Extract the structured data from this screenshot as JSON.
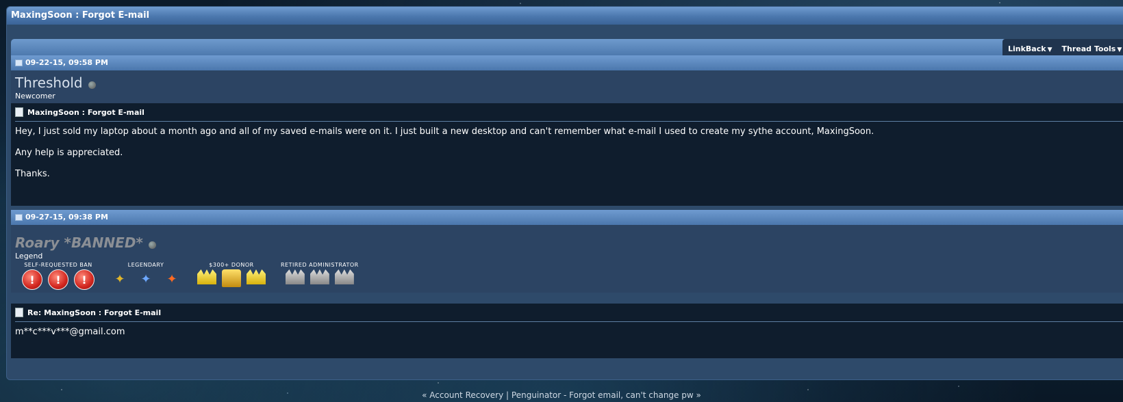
{
  "thread": {
    "title": "MaxingSoon : Forgot E-mail"
  },
  "toolbar": {
    "linkback": "LinkBack",
    "thread_tools": "Thread Tools"
  },
  "posts": [
    {
      "date": "09-22-15, 09:58 PM",
      "username": "Threshold",
      "usertitle": "Newcomer",
      "title": "MaxingSoon : Forgot E-mail",
      "paragraphs": [
        "Hey, I just sold my laptop about a month ago and all of my saved e-mails were on it. I just built a new desktop and can't remember what e-mail I used to create my sythe account, MaxingSoon.",
        "Any help is appreciated.",
        "Thanks."
      ]
    },
    {
      "date": "09-27-15, 09:38 PM",
      "username": "Roary *BANNED*",
      "usertitle": "Legend",
      "awards": [
        {
          "label": "SELF-REQUESTED BAN",
          "count": 3,
          "icon": "ban-badge-icon"
        },
        {
          "label": "LEGENDARY",
          "count": 3,
          "icon": "legendary-bird-icon"
        },
        {
          "label": "$300+ DONOR",
          "count": 3,
          "icon": "gold-crown-icon"
        },
        {
          "label": "RETIRED ADMINISTRATOR",
          "count": 3,
          "icon": "silver-crown-icon"
        }
      ],
      "title": "Re: MaxingSoon : Forgot E-mail",
      "paragraphs": [
        "m**c***v***@gmail.com"
      ]
    }
  ],
  "footer": {
    "prev": "« Account Recovery",
    "sep": "|",
    "next": "Penguinator - Forgot email, can't change pw »"
  }
}
